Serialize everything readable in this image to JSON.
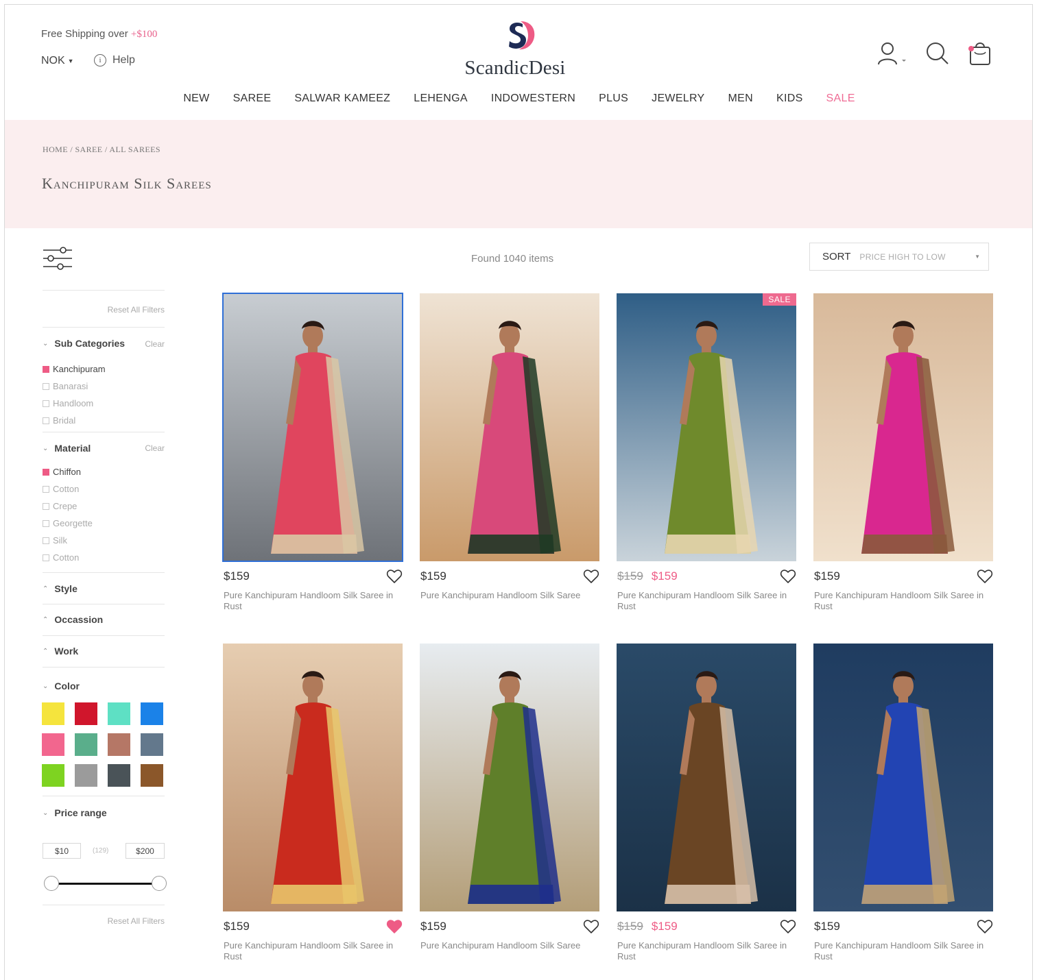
{
  "header": {
    "shipping_text": "Free Shipping over",
    "shipping_amount": "+$100",
    "currency": "NOK",
    "help": "Help",
    "brand": "ScandicDesi"
  },
  "nav": [
    "NEW",
    "SAREE",
    "SALWAR KAMEEZ",
    "LEHENGA",
    "INDOWESTERN",
    "PLUS",
    "JEWELRY",
    "MEN",
    "KIDS",
    "SALE"
  ],
  "banner": {
    "breadcrumb": [
      "HOME",
      "SAREE",
      "ALL SAREES"
    ],
    "title": "Kanchipuram Silk Sarees"
  },
  "filters": {
    "reset": "Reset All Filters",
    "clear": "Clear",
    "sub_categories": {
      "title": "Sub Categories",
      "options": [
        {
          "label": "Kanchipuram",
          "checked": true
        },
        {
          "label": "Banarasi",
          "checked": false
        },
        {
          "label": "Handloom",
          "checked": false
        },
        {
          "label": "Bridal",
          "checked": false
        }
      ]
    },
    "material": {
      "title": "Material",
      "options": [
        {
          "label": "Chiffon",
          "checked": true
        },
        {
          "label": "Cotton",
          "checked": false
        },
        {
          "label": "Crepe",
          "checked": false
        },
        {
          "label": "Georgette",
          "checked": false
        },
        {
          "label": "Silk",
          "checked": false
        },
        {
          "label": "Cotton",
          "checked": false
        }
      ]
    },
    "style": "Style",
    "occasion": "Occassion",
    "work": "Work",
    "color": {
      "title": "Color",
      "swatches": [
        "#f5e43d",
        "#d0162c",
        "#5ee0c4",
        "#1b82e8",
        "#f2668e",
        "#5aae8b",
        "#b57766",
        "#63788c",
        "#7ed321",
        "#9b9b9b",
        "#4a5358",
        "#8b572a"
      ]
    },
    "price": {
      "title": "Price range",
      "min": "$10",
      "count": "(129)",
      "max": "$200"
    }
  },
  "results": {
    "found": "Found 1040 items",
    "sort_label": "SORT",
    "sort_value": "PRICE HIGH TO LOW"
  },
  "products": [
    {
      "price": "$159",
      "old_price": "",
      "name": "Pure Kanchipuram Handloom Silk Saree in Rust",
      "sale": false,
      "liked": false,
      "selected": true,
      "palette": [
        "#c8cdd2",
        "#e0455e",
        "#d9c7a4",
        "#6e7278"
      ]
    },
    {
      "price": "$159",
      "old_price": "",
      "name": "Pure Kanchipuram Handloom Silk Saree",
      "sale": false,
      "liked": false,
      "selected": false,
      "palette": [
        "#efe3d4",
        "#d8497a",
        "#1f3a25",
        "#c99a6a"
      ]
    },
    {
      "price": "$159",
      "old_price": "$159",
      "name": "Pure Kanchipuram Handloom Silk Saree in Rust",
      "sale": true,
      "sale_label": "SALE",
      "liked": false,
      "selected": false,
      "palette": [
        "#2f5e86",
        "#6f8a2c",
        "#e8d6b0",
        "#c9d3da"
      ]
    },
    {
      "price": "$159",
      "old_price": "",
      "name": "Pure Kanchipuram Handloom Silk Saree in Rust",
      "sale": false,
      "liked": false,
      "selected": false,
      "palette": [
        "#d8b99a",
        "#d9278f",
        "#8a5a3c",
        "#f0e0cc"
      ]
    },
    {
      "price": "$159",
      "old_price": "",
      "name": "Pure Kanchipuram Handloom Silk Saree in Rust",
      "sale": false,
      "liked": true,
      "selected": false,
      "palette": [
        "#e6cdb1",
        "#c92b1e",
        "#e8c56a",
        "#b98c68"
      ]
    },
    {
      "price": "$159",
      "old_price": "",
      "name": "Pure Kanchipuram Handloom Silk Saree",
      "sale": false,
      "liked": false,
      "selected": false,
      "palette": [
        "#e7ecf0",
        "#5f7f2a",
        "#1e2f8c",
        "#b49e78"
      ]
    },
    {
      "price": "$159",
      "old_price": "$159",
      "name": "Pure Kanchipuram Handloom Silk Saree in Rust",
      "sale": false,
      "liked": false,
      "selected": false,
      "palette": [
        "#2a4a68",
        "#6a4524",
        "#d6bfa8",
        "#1b3147"
      ]
    },
    {
      "price": "$159",
      "old_price": "",
      "name": "Pure Kanchipuram Handloom Silk Saree in Rust",
      "sale": false,
      "liked": false,
      "selected": false,
      "palette": [
        "#1f3c60",
        "#2244b3",
        "#c2a372",
        "#334f70"
      ]
    }
  ]
}
